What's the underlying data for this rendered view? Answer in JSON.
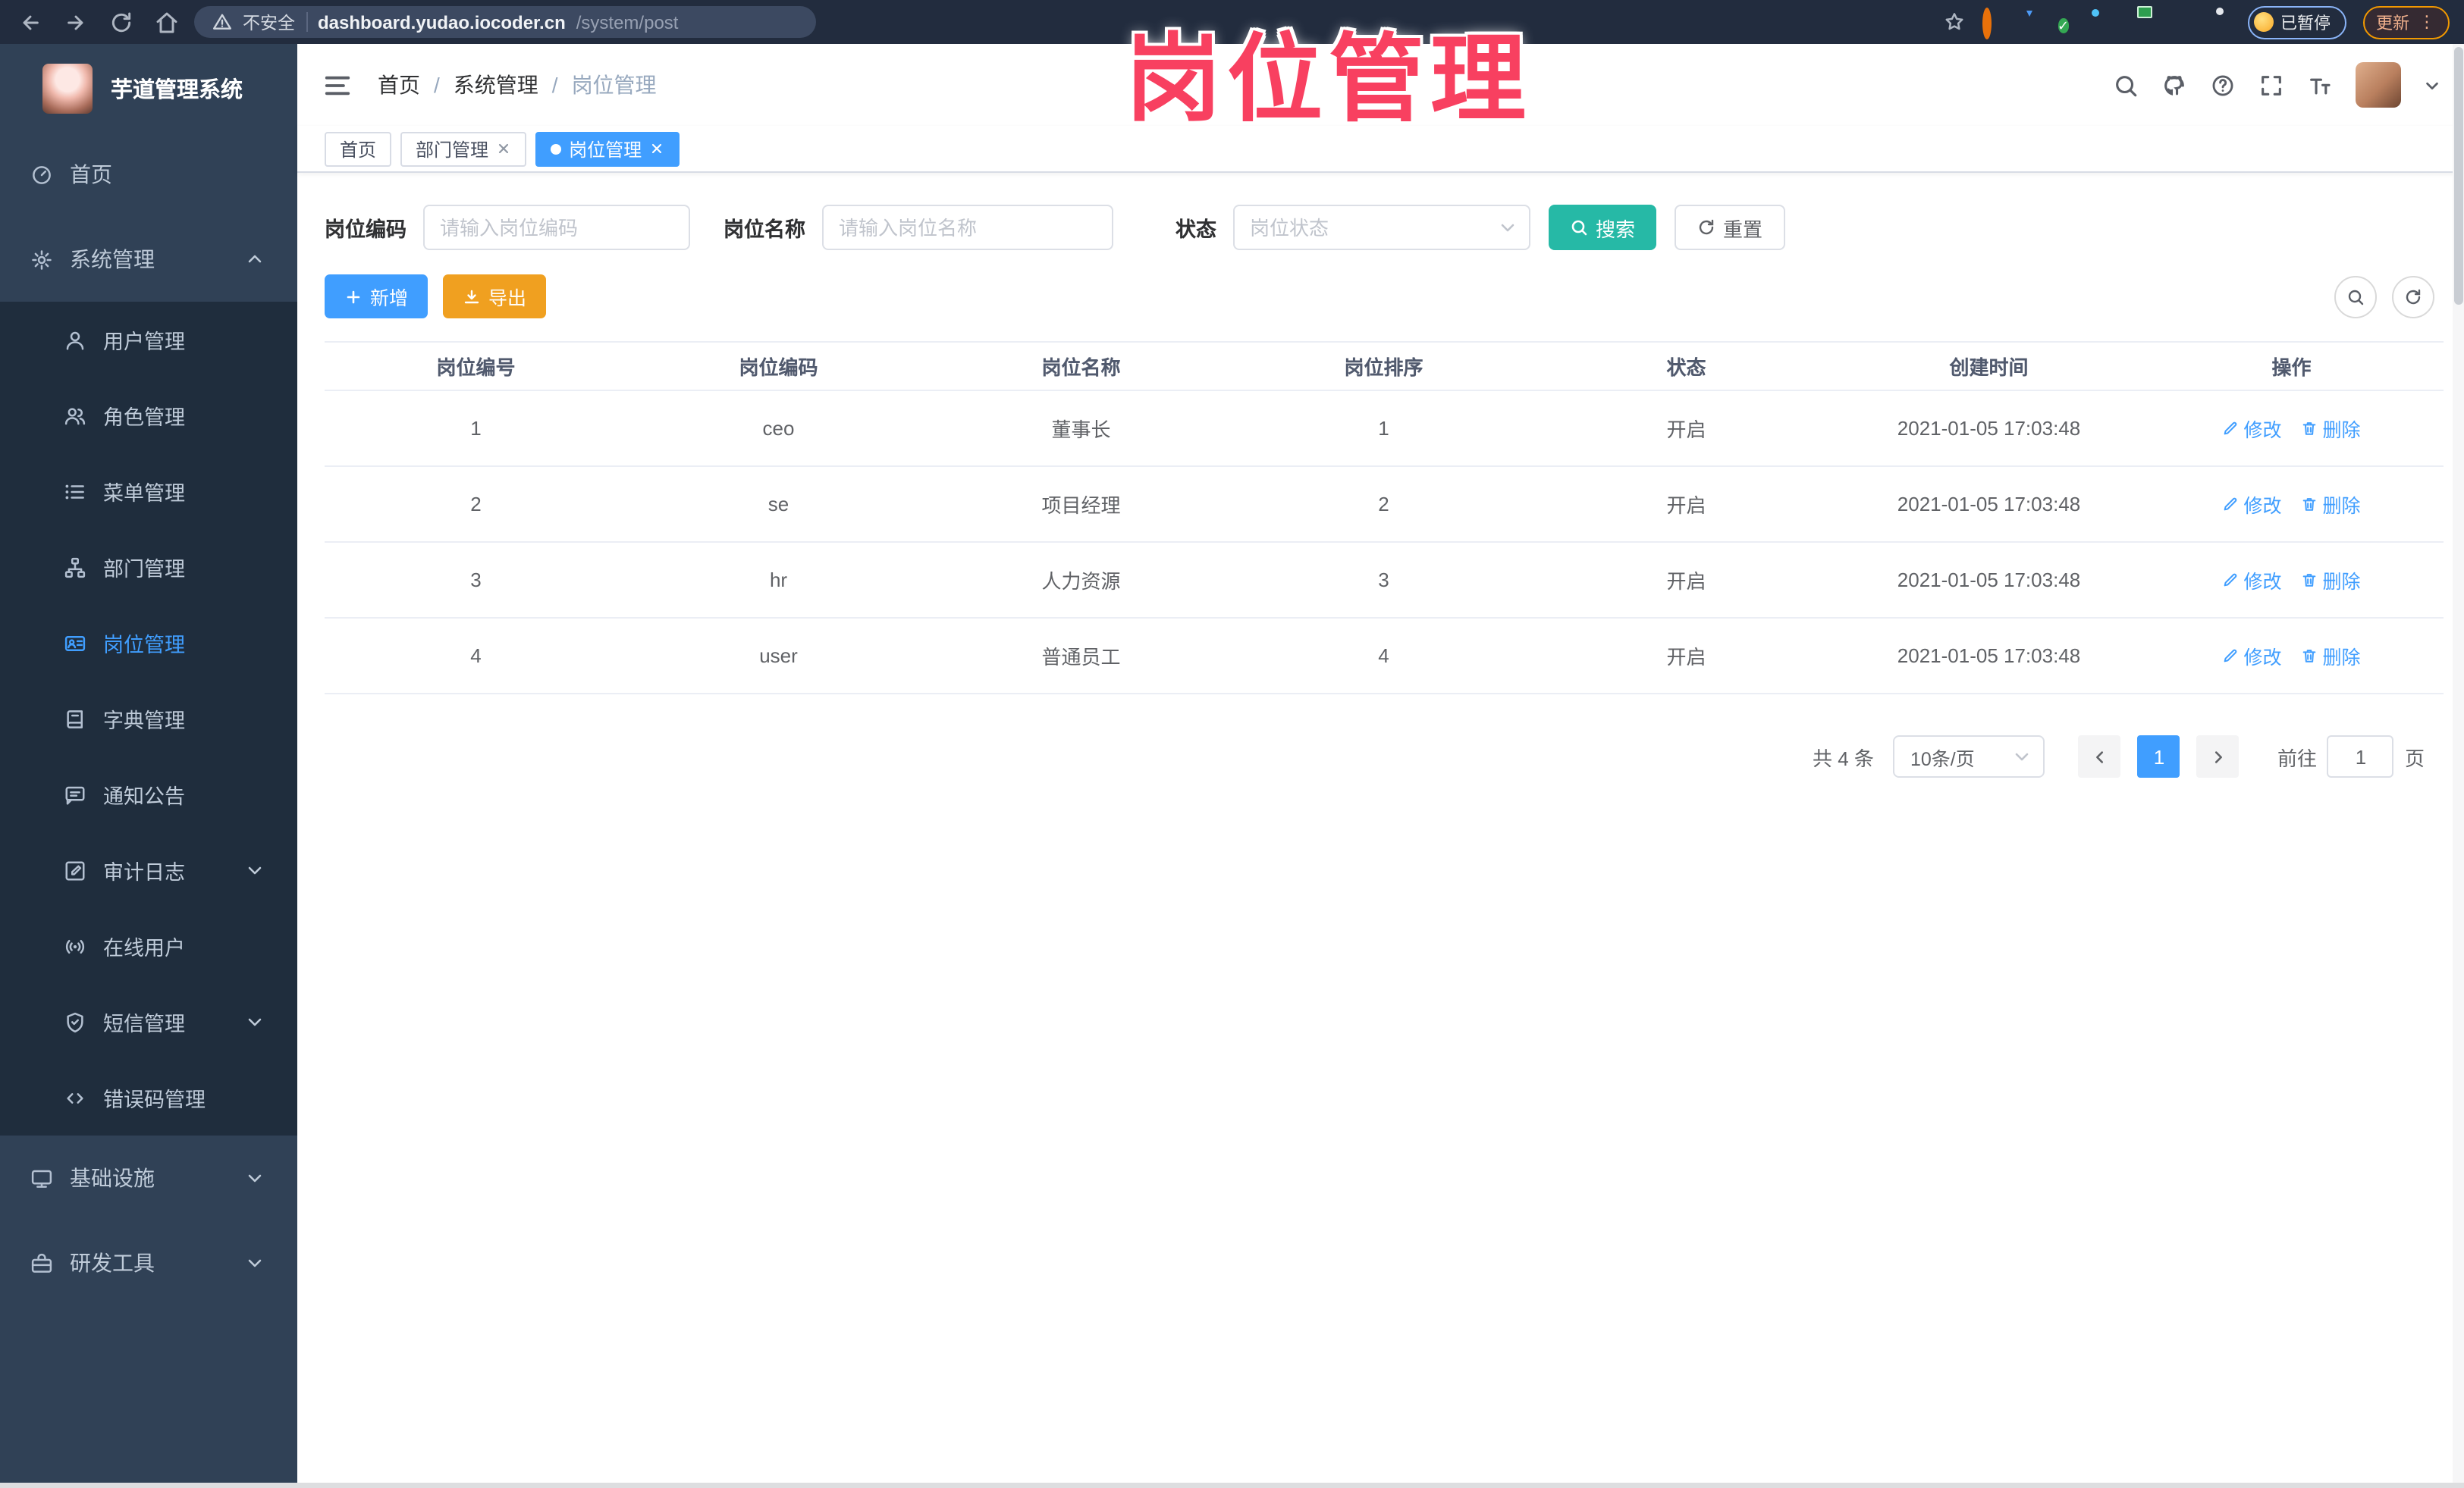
{
  "overlay": {
    "title": "岗位管理"
  },
  "browser": {
    "security_label": "不安全",
    "url_host": "dashboard.yudao.iocoder.cn",
    "url_path": "/system/post",
    "paused_label": "已暂停",
    "update_label": "更新"
  },
  "sidebar": {
    "app_title": "芋道管理系统",
    "items": [
      {
        "label": "首页",
        "icon": "dashboard-icon",
        "level": "top",
        "active": false,
        "chevron": null
      },
      {
        "label": "系统管理",
        "icon": "gear-icon",
        "level": "top",
        "active": false,
        "chevron": "up"
      },
      {
        "label": "用户管理",
        "icon": "user-icon",
        "level": "sub",
        "active": false,
        "chevron": null
      },
      {
        "label": "角色管理",
        "icon": "users-icon",
        "level": "sub",
        "active": false,
        "chevron": null
      },
      {
        "label": "菜单管理",
        "icon": "menu-list-icon",
        "level": "sub",
        "active": false,
        "chevron": null
      },
      {
        "label": "部门管理",
        "icon": "org-tree-icon",
        "level": "sub",
        "active": false,
        "chevron": null
      },
      {
        "label": "岗位管理",
        "icon": "badge-icon",
        "level": "sub",
        "active": true,
        "chevron": null
      },
      {
        "label": "字典管理",
        "icon": "book-icon",
        "level": "sub",
        "active": false,
        "chevron": null
      },
      {
        "label": "通知公告",
        "icon": "message-icon",
        "level": "sub",
        "active": false,
        "chevron": null
      },
      {
        "label": "审计日志",
        "icon": "log-icon",
        "level": "sub",
        "active": false,
        "chevron": "down"
      },
      {
        "label": "在线用户",
        "icon": "online-icon",
        "level": "sub",
        "active": false,
        "chevron": null
      },
      {
        "label": "短信管理",
        "icon": "shield-icon",
        "level": "sub",
        "active": false,
        "chevron": "down"
      },
      {
        "label": "错误码管理",
        "icon": "code-icon",
        "level": "sub",
        "active": false,
        "chevron": null
      },
      {
        "label": "基础设施",
        "icon": "monitor-icon",
        "level": "top",
        "active": false,
        "chevron": "down"
      },
      {
        "label": "研发工具",
        "icon": "toolbox-icon",
        "level": "top",
        "active": false,
        "chevron": "down"
      }
    ]
  },
  "header": {
    "breadcrumb": [
      "首页",
      "系统管理",
      "岗位管理"
    ]
  },
  "tabs": [
    {
      "label": "首页",
      "active": false,
      "closable": false
    },
    {
      "label": "部门管理",
      "active": false,
      "closable": true
    },
    {
      "label": "岗位管理",
      "active": true,
      "closable": true
    }
  ],
  "filters": {
    "post_code_label": "岗位编码",
    "post_code_placeholder": "请输入岗位编码",
    "post_name_label": "岗位名称",
    "post_name_placeholder": "请输入岗位名称",
    "status_label": "状态",
    "status_placeholder": "岗位状态",
    "search_label": "搜索",
    "reset_label": "重置"
  },
  "toolbar": {
    "add_label": "新增",
    "export_label": "导出"
  },
  "table": {
    "columns": [
      "岗位编号",
      "岗位编码",
      "岗位名称",
      "岗位排序",
      "状态",
      "创建时间",
      "操作"
    ],
    "edit_label": "修改",
    "delete_label": "删除",
    "rows": [
      {
        "id": "1",
        "code": "ceo",
        "name": "董事长",
        "sort": "1",
        "status": "开启",
        "created": "2021-01-05 17:03:48"
      },
      {
        "id": "2",
        "code": "se",
        "name": "项目经理",
        "sort": "2",
        "status": "开启",
        "created": "2021-01-05 17:03:48"
      },
      {
        "id": "3",
        "code": "hr",
        "name": "人力资源",
        "sort": "3",
        "status": "开启",
        "created": "2021-01-05 17:03:48"
      },
      {
        "id": "4",
        "code": "user",
        "name": "普通员工",
        "sort": "4",
        "status": "开启",
        "created": "2021-01-05 17:03:48"
      }
    ]
  },
  "pagination": {
    "total_label": "共 4 条",
    "page_size": "10条/页",
    "current_page": "1",
    "goto_label": "前往",
    "goto_value": "1",
    "page_unit": "页"
  },
  "colors": {
    "accent_blue": "#409eff",
    "teal_search": "#26b9a6",
    "orange_export": "#f0a020",
    "sidebar_bg": "#304156",
    "submenu_bg": "#1f2d3d",
    "overlay_pink": "#f84060"
  }
}
